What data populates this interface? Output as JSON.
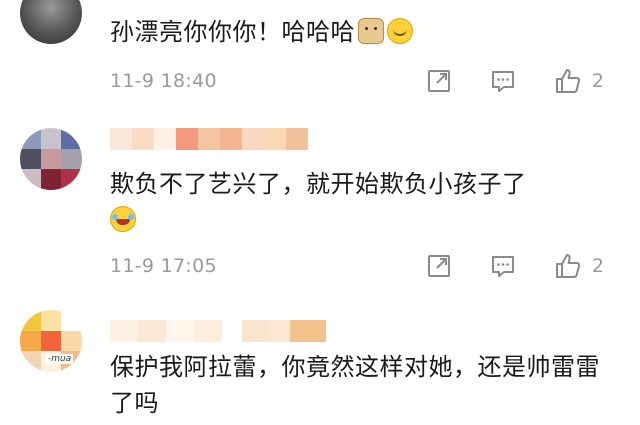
{
  "comments": [
    {
      "text": "孙漂亮你你你！哈哈哈",
      "emojis": [
        "doge-icon",
        "smile-icon"
      ],
      "time": "11-9 18:40",
      "likes": "2"
    },
    {
      "text": "欺负不了艺兴了，就开始欺负小孩子了",
      "emojis": [
        "laugh-cry-icon"
      ],
      "time": "11-9 17:05",
      "likes": "2"
    },
    {
      "text": "保护我阿拉蕾，你竟然这样对她，还是帅雷雷了吗",
      "avatar_tag": "-mua"
    }
  ],
  "colors": {
    "text": "#1a1a1a",
    "meta": "#9a9a9a",
    "icon": "#8a8a8a"
  }
}
